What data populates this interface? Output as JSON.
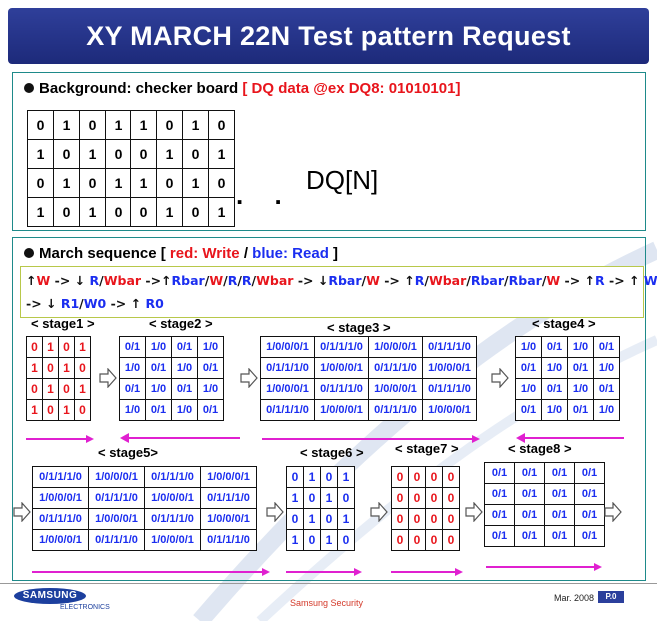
{
  "title": "XY MARCH 22N Test pattern Request",
  "background": {
    "label": "Background: checker board",
    "dq_note": "[ DQ data @ex DQ8: 01010101]",
    "grid_a": [
      [
        "0",
        "1",
        "0",
        "1"
      ],
      [
        "1",
        "0",
        "1",
        "0"
      ],
      [
        "0",
        "1",
        "0",
        "1"
      ],
      [
        "1",
        "0",
        "1",
        "0"
      ]
    ],
    "grid_b": [
      [
        "1",
        "0",
        "1",
        "0"
      ],
      [
        "0",
        "1",
        "0",
        "1"
      ],
      [
        "1",
        "0",
        "1",
        "0"
      ],
      [
        "0",
        "1",
        "0",
        "1"
      ]
    ],
    "dots": ". .",
    "dq_n": "DQ[N]"
  },
  "march": {
    "label": "March sequence [",
    "red_key": "red:",
    "write_word": "Write",
    "slash": "/",
    "blue_key": "blue:",
    "read_word": "Read",
    "close": "]",
    "seq_line1": [
      {
        "t": "↑",
        "c": "k"
      },
      {
        "t": "W",
        "c": "r"
      },
      {
        "t": " -> ↓ ",
        "c": "k"
      },
      {
        "t": "R",
        "c": "b"
      },
      {
        "t": "/",
        "c": "k"
      },
      {
        "t": "Wbar",
        "c": "r"
      },
      {
        "t": " ->↑",
        "c": "k"
      },
      {
        "t": "Rbar",
        "c": "b"
      },
      {
        "t": "/",
        "c": "k"
      },
      {
        "t": "W",
        "c": "r"
      },
      {
        "t": "/",
        "c": "k"
      },
      {
        "t": "R",
        "c": "b"
      },
      {
        "t": "/",
        "c": "k"
      },
      {
        "t": "R",
        "c": "b"
      },
      {
        "t": "/",
        "c": "k"
      },
      {
        "t": "Wbar",
        "c": "r"
      },
      {
        "t": " -> ↓",
        "c": "k"
      },
      {
        "t": "Rbar",
        "c": "b"
      },
      {
        "t": "/",
        "c": "k"
      },
      {
        "t": "W",
        "c": "r"
      },
      {
        "t": " -> ↑",
        "c": "k"
      },
      {
        "t": "R",
        "c": "b"
      },
      {
        "t": "/",
        "c": "k"
      },
      {
        "t": "Wbar",
        "c": "r"
      },
      {
        "t": "/",
        "c": "k"
      },
      {
        "t": "Rbar",
        "c": "b"
      },
      {
        "t": "/",
        "c": "k"
      },
      {
        "t": "Rbar",
        "c": "b"
      },
      {
        "t": "/",
        "c": "k"
      },
      {
        "t": "W",
        "c": "r"
      },
      {
        "t": " -> ↑",
        "c": "k"
      },
      {
        "t": "R",
        "c": "b"
      },
      {
        "t": " -> ↑ ",
        "c": "k"
      },
      {
        "t": "W0",
        "c": "b"
      },
      {
        "t": " -> ↑ ",
        "c": "k"
      },
      {
        "t": "R0",
        "c": "b"
      },
      {
        "t": "/",
        "c": "k"
      },
      {
        "t": "W1",
        "c": "b"
      }
    ],
    "seq_line2": [
      {
        "t": "-> ↓ ",
        "c": "k"
      },
      {
        "t": "R1",
        "c": "b"
      },
      {
        "t": "/",
        "c": "k"
      },
      {
        "t": "W0",
        "c": "b"
      },
      {
        "t": " -> ↑ ",
        "c": "k"
      },
      {
        "t": "R0",
        "c": "b"
      }
    ]
  },
  "stages": {
    "stage1": {
      "label": "< stage1 >",
      "cells": [
        [
          {
            "v": "0",
            "c": "red"
          },
          {
            "v": "1",
            "c": "red"
          },
          {
            "v": "0",
            "c": "red"
          },
          {
            "v": "1",
            "c": "red"
          }
        ],
        [
          {
            "v": "1",
            "c": "red"
          },
          {
            "v": "0",
            "c": "red"
          },
          {
            "v": "1",
            "c": "red"
          },
          {
            "v": "0",
            "c": "red"
          }
        ],
        [
          {
            "v": "0",
            "c": "red"
          },
          {
            "v": "1",
            "c": "red"
          },
          {
            "v": "0",
            "c": "red"
          },
          {
            "v": "1",
            "c": "red"
          }
        ],
        [
          {
            "v": "1",
            "c": "red"
          },
          {
            "v": "0",
            "c": "red"
          },
          {
            "v": "1",
            "c": "red"
          },
          {
            "v": "0",
            "c": "red"
          }
        ]
      ]
    },
    "stage2": {
      "label": "< stage2 >",
      "cells": [
        [
          {
            "v": "0/1",
            "c": "blue"
          },
          {
            "v": "1/0",
            "c": "blue"
          },
          {
            "v": "0/1",
            "c": "blue"
          },
          {
            "v": "1/0",
            "c": "blue"
          }
        ],
        [
          {
            "v": "1/0",
            "c": "blue"
          },
          {
            "v": "0/1",
            "c": "blue"
          },
          {
            "v": "1/0",
            "c": "blue"
          },
          {
            "v": "0/1",
            "c": "blue"
          }
        ],
        [
          {
            "v": "0/1",
            "c": "blue"
          },
          {
            "v": "1/0",
            "c": "blue"
          },
          {
            "v": "0/1",
            "c": "blue"
          },
          {
            "v": "1/0",
            "c": "blue"
          }
        ],
        [
          {
            "v": "1/0",
            "c": "blue"
          },
          {
            "v": "0/1",
            "c": "blue"
          },
          {
            "v": "1/0",
            "c": "blue"
          },
          {
            "v": "0/1",
            "c": "blue"
          }
        ]
      ]
    },
    "stage3": {
      "label": "< stage3 >",
      "cells": [
        [
          {
            "v": "1/0/0/0/1",
            "c": "blue"
          },
          {
            "v": "0/1/1/1/0",
            "c": "blue"
          },
          {
            "v": "1/0/0/0/1",
            "c": "blue"
          },
          {
            "v": "0/1/1/1/0",
            "c": "blue"
          }
        ],
        [
          {
            "v": "0/1/1/1/0",
            "c": "blue"
          },
          {
            "v": "1/0/0/0/1",
            "c": "blue"
          },
          {
            "v": "0/1/1/1/0",
            "c": "blue"
          },
          {
            "v": "1/0/0/0/1",
            "c": "blue"
          }
        ],
        [
          {
            "v": "1/0/0/0/1",
            "c": "blue"
          },
          {
            "v": "0/1/1/1/0",
            "c": "blue"
          },
          {
            "v": "1/0/0/0/1",
            "c": "blue"
          },
          {
            "v": "0/1/1/1/0",
            "c": "blue"
          }
        ],
        [
          {
            "v": "0/1/1/1/0",
            "c": "blue"
          },
          {
            "v": "1/0/0/0/1",
            "c": "blue"
          },
          {
            "v": "0/1/1/1/0",
            "c": "blue"
          },
          {
            "v": "1/0/0/0/1",
            "c": "blue"
          }
        ]
      ]
    },
    "stage4": {
      "label": "< stage4 >",
      "cells": [
        [
          {
            "v": "1/0",
            "c": "blue"
          },
          {
            "v": "0/1",
            "c": "blue"
          },
          {
            "v": "1/0",
            "c": "blue"
          },
          {
            "v": "0/1",
            "c": "blue"
          }
        ],
        [
          {
            "v": "0/1",
            "c": "blue"
          },
          {
            "v": "1/0",
            "c": "blue"
          },
          {
            "v": "0/1",
            "c": "blue"
          },
          {
            "v": "1/0",
            "c": "blue"
          }
        ],
        [
          {
            "v": "1/0",
            "c": "blue"
          },
          {
            "v": "0/1",
            "c": "blue"
          },
          {
            "v": "1/0",
            "c": "blue"
          },
          {
            "v": "0/1",
            "c": "blue"
          }
        ],
        [
          {
            "v": "0/1",
            "c": "blue"
          },
          {
            "v": "1/0",
            "c": "blue"
          },
          {
            "v": "0/1",
            "c": "blue"
          },
          {
            "v": "1/0",
            "c": "blue"
          }
        ]
      ]
    },
    "stage5": {
      "label": "< stage5>",
      "cells": [
        [
          {
            "v": "0/1/1/1/0",
            "c": "blue"
          },
          {
            "v": "1/0/0/0/1",
            "c": "blue"
          },
          {
            "v": "0/1/1/1/0",
            "c": "blue"
          },
          {
            "v": "1/0/0/0/1",
            "c": "blue"
          }
        ],
        [
          {
            "v": "1/0/0/0/1",
            "c": "blue"
          },
          {
            "v": "0/1/1/1/0",
            "c": "blue"
          },
          {
            "v": "1/0/0/0/1",
            "c": "blue"
          },
          {
            "v": "0/1/1/1/0",
            "c": "blue"
          }
        ],
        [
          {
            "v": "0/1/1/1/0",
            "c": "blue"
          },
          {
            "v": "1/0/0/0/1",
            "c": "blue"
          },
          {
            "v": "0/1/1/1/0",
            "c": "blue"
          },
          {
            "v": "1/0/0/0/1",
            "c": "blue"
          }
        ],
        [
          {
            "v": "1/0/0/0/1",
            "c": "blue"
          },
          {
            "v": "0/1/1/1/0",
            "c": "blue"
          },
          {
            "v": "1/0/0/0/1",
            "c": "blue"
          },
          {
            "v": "0/1/1/1/0",
            "c": "blue"
          }
        ]
      ]
    },
    "stage6": {
      "label": "< stage6 >",
      "cells": [
        [
          {
            "v": "0",
            "c": "blue"
          },
          {
            "v": "1",
            "c": "blue"
          },
          {
            "v": "0",
            "c": "blue"
          },
          {
            "v": "1",
            "c": "blue"
          }
        ],
        [
          {
            "v": "1",
            "c": "blue"
          },
          {
            "v": "0",
            "c": "blue"
          },
          {
            "v": "1",
            "c": "blue"
          },
          {
            "v": "0",
            "c": "blue"
          }
        ],
        [
          {
            "v": "0",
            "c": "blue"
          },
          {
            "v": "1",
            "c": "blue"
          },
          {
            "v": "0",
            "c": "blue"
          },
          {
            "v": "1",
            "c": "blue"
          }
        ],
        [
          {
            "v": "1",
            "c": "blue"
          },
          {
            "v": "0",
            "c": "blue"
          },
          {
            "v": "1",
            "c": "blue"
          },
          {
            "v": "0",
            "c": "blue"
          }
        ]
      ]
    },
    "stage7": {
      "label": "< stage7 >",
      "cells": [
        [
          {
            "v": "0",
            "c": "red"
          },
          {
            "v": "0",
            "c": "red"
          },
          {
            "v": "0",
            "c": "red"
          },
          {
            "v": "0",
            "c": "red"
          }
        ],
        [
          {
            "v": "0",
            "c": "red"
          },
          {
            "v": "0",
            "c": "red"
          },
          {
            "v": "0",
            "c": "red"
          },
          {
            "v": "0",
            "c": "red"
          }
        ],
        [
          {
            "v": "0",
            "c": "red"
          },
          {
            "v": "0",
            "c": "red"
          },
          {
            "v": "0",
            "c": "red"
          },
          {
            "v": "0",
            "c": "red"
          }
        ],
        [
          {
            "v": "0",
            "c": "red"
          },
          {
            "v": "0",
            "c": "red"
          },
          {
            "v": "0",
            "c": "red"
          },
          {
            "v": "0",
            "c": "red"
          }
        ]
      ]
    },
    "stage8": {
      "label": "< stage8 >",
      "cells": [
        [
          {
            "v": "0/1",
            "c": "blue"
          },
          {
            "v": "0/1",
            "c": "blue"
          },
          {
            "v": "0/1",
            "c": "blue"
          },
          {
            "v": "0/1",
            "c": "blue"
          }
        ],
        [
          {
            "v": "0/1",
            "c": "blue"
          },
          {
            "v": "0/1",
            "c": "blue"
          },
          {
            "v": "0/1",
            "c": "blue"
          },
          {
            "v": "0/1",
            "c": "blue"
          }
        ],
        [
          {
            "v": "0/1",
            "c": "blue"
          },
          {
            "v": "0/1",
            "c": "blue"
          },
          {
            "v": "0/1",
            "c": "blue"
          },
          {
            "v": "0/1",
            "c": "blue"
          }
        ],
        [
          {
            "v": "0/1",
            "c": "blue"
          },
          {
            "v": "0/1",
            "c": "blue"
          },
          {
            "v": "0/1",
            "c": "blue"
          },
          {
            "v": "0/1",
            "c": "blue"
          }
        ]
      ]
    }
  },
  "footer": {
    "logo": "SAMSUNG",
    "electronics": "ELECTRONICS",
    "center": "Samsung Security",
    "date": "Mar.  2008",
    "page": "P.0"
  },
  "colors": {
    "title_bg": "#2b3a94",
    "panel_border": "#1e8a8a",
    "write_red": "#e8151c",
    "read_blue": "#1b2ef0",
    "arrow_pink": "#e020d0"
  }
}
